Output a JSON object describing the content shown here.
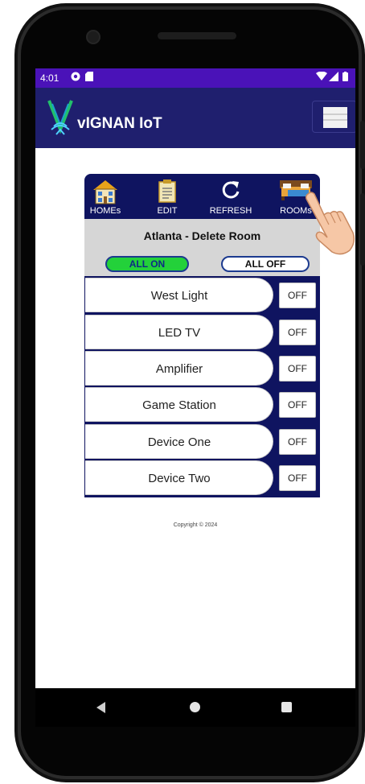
{
  "status_bar": {
    "time": "4:01"
  },
  "app_bar": {
    "title": "vIGNAN IoT"
  },
  "toolbar": {
    "items": [
      {
        "label": "HOMEs",
        "icon": "house-icon"
      },
      {
        "label": "EDIT",
        "icon": "edit-document-icon"
      },
      {
        "label": "REFRESH",
        "icon": "refresh-icon"
      },
      {
        "label": "ROOMs",
        "icon": "bedroom-icon"
      }
    ]
  },
  "room": {
    "title": "Atlanta - Delete Room",
    "all_on_label": "ALL ON",
    "all_off_label": "ALL OFF"
  },
  "devices": [
    {
      "name": "West Light",
      "state": "OFF"
    },
    {
      "name": "LED TV",
      "state": "OFF"
    },
    {
      "name": "Amplifier",
      "state": "OFF"
    },
    {
      "name": "Game Station",
      "state": "OFF"
    },
    {
      "name": "Device One",
      "state": "OFF"
    },
    {
      "name": "Device Two",
      "state": "OFF"
    }
  ],
  "footer": {
    "copyright": "Copyright © 2024"
  },
  "colors": {
    "status_bar": "#4a12b8",
    "app_bar": "#1f1f6e",
    "card": "#0f1460",
    "all_on": "#23d13a"
  }
}
